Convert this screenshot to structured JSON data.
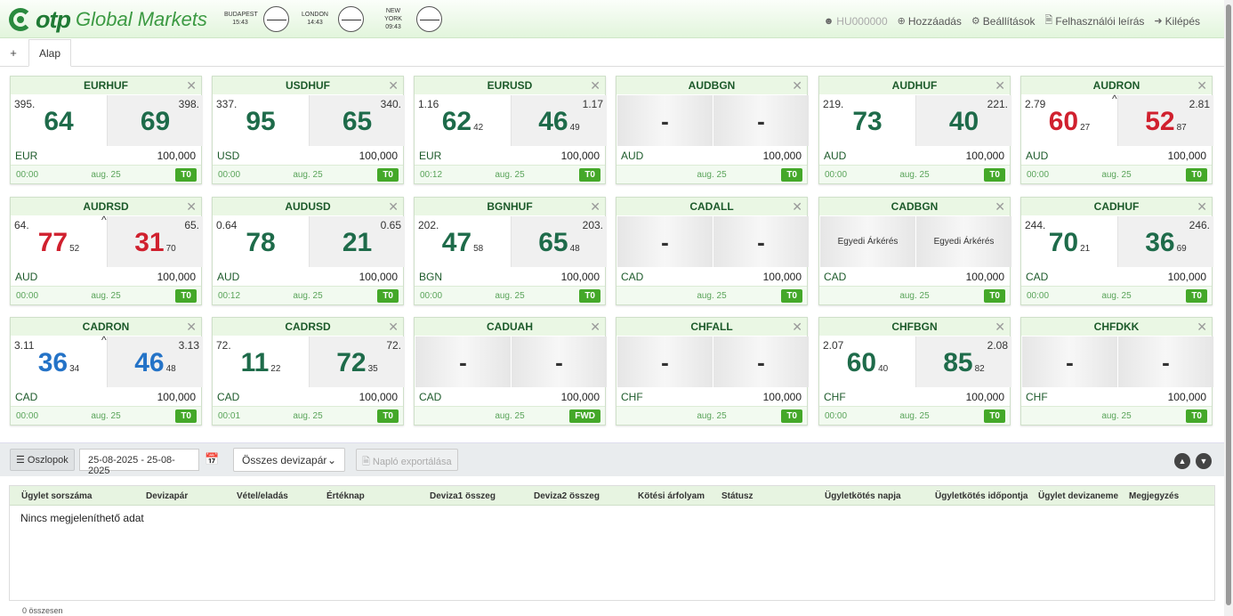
{
  "header": {
    "logo_brand": "otp",
    "logo_product": "Global Markets",
    "clocks": [
      {
        "city": "BUDAPEST",
        "time": "15:43"
      },
      {
        "city": "LONDON",
        "time": "14:43"
      },
      {
        "city": "NEW YORK",
        "time": "09:43"
      }
    ],
    "nav": {
      "user": "HU000000",
      "add": "Hozzáadás",
      "settings": "Beállítások",
      "manual": "Felhasználói leírás",
      "logout": "Kilépés"
    }
  },
  "tabs": {
    "add_symbol": "+",
    "active": "Alap"
  },
  "tiles": [
    {
      "pair": "EURHUF",
      "sell": {
        "pre": "395.",
        "big": "64",
        "small": ""
      },
      "buy": {
        "pre": "398.",
        "big": "69",
        "small": ""
      },
      "currency": "EUR",
      "amount": "100,000",
      "time": "00:00",
      "date": "aug. 25",
      "tenor": "T0"
    },
    {
      "pair": "USDHUF",
      "sell": {
        "pre": "337.",
        "big": "95",
        "small": ""
      },
      "buy": {
        "pre": "340.",
        "big": "65",
        "small": ""
      },
      "currency": "USD",
      "amount": "100,000",
      "time": "00:00",
      "date": "aug. 25",
      "tenor": "T0"
    },
    {
      "pair": "EURUSD",
      "sell": {
        "pre": "1.16",
        "big": "62",
        "small": "42"
      },
      "buy": {
        "pre": "1.17",
        "big": "46",
        "small": "49"
      },
      "currency": "EUR",
      "amount": "100,000",
      "time": "00:12",
      "date": "aug. 25",
      "tenor": "T0"
    },
    {
      "pair": "AUDBGN",
      "sell": {
        "pre": "",
        "big": "-",
        "small": ""
      },
      "buy": {
        "pre": "",
        "big": "-",
        "small": ""
      },
      "currency": "AUD",
      "amount": "100,000",
      "time": "",
      "date": "aug. 25",
      "tenor": "T0"
    },
    {
      "pair": "AUDHUF",
      "sell": {
        "pre": "219.",
        "big": "73",
        "small": ""
      },
      "buy": {
        "pre": "221.",
        "big": "40",
        "small": ""
      },
      "currency": "AUD",
      "amount": "100,000",
      "time": "00:00",
      "date": "aug. 25",
      "tenor": "T0"
    },
    {
      "pair": "AUDRON",
      "sell": {
        "pre": "2.79",
        "big": "60",
        "small": "27"
      },
      "buy": {
        "pre": "2.81",
        "big": "52",
        "small": "87"
      },
      "currency": "AUD",
      "amount": "100,000",
      "time": "00:00",
      "date": "aug. 25",
      "tenor": "T0",
      "arrow": "^"
    },
    {
      "pair": "AUDRSD",
      "sell": {
        "pre": "64.",
        "big": "77",
        "small": "52"
      },
      "buy": {
        "pre": "65.",
        "big": "31",
        "small": "70"
      },
      "currency": "AUD",
      "amount": "100,000",
      "time": "00:00",
      "date": "aug. 25",
      "tenor": "T0",
      "arrow": "^"
    },
    {
      "pair": "AUDUSD",
      "sell": {
        "pre": "0.64",
        "big": "78",
        "small": ""
      },
      "buy": {
        "pre": "0.65",
        "big": "21",
        "small": ""
      },
      "currency": "AUD",
      "amount": "100,000",
      "time": "00:12",
      "date": "aug. 25",
      "tenor": "T0"
    },
    {
      "pair": "BGNHUF",
      "sell": {
        "pre": "202.",
        "big": "47",
        "small": "58"
      },
      "buy": {
        "pre": "203.",
        "big": "65",
        "small": "48"
      },
      "currency": "BGN",
      "amount": "100,000",
      "time": "00:00",
      "date": "aug. 25",
      "tenor": "T0"
    },
    {
      "pair": "CADALL",
      "sell": {
        "pre": "",
        "big": "-",
        "small": ""
      },
      "buy": {
        "pre": "",
        "big": "-",
        "small": ""
      },
      "currency": "CAD",
      "amount": "100,000",
      "time": "",
      "date": "aug. 25",
      "tenor": "T0"
    },
    {
      "pair": "CADBGN",
      "sell": {
        "pre": "",
        "big": "",
        "small": "",
        "custom": "Egyedi Árkérés"
      },
      "buy": {
        "pre": "",
        "big": "",
        "small": "",
        "custom": "Egyedi Árkérés"
      },
      "currency": "CAD",
      "amount": "100,000",
      "time": "",
      "date": "aug. 25",
      "tenor": "T0"
    },
    {
      "pair": "CADHUF",
      "sell": {
        "pre": "244.",
        "big": "70",
        "small": "21"
      },
      "buy": {
        "pre": "246.",
        "big": "36",
        "small": "69"
      },
      "currency": "CAD",
      "amount": "100,000",
      "time": "00:00",
      "date": "aug. 25",
      "tenor": "T0"
    },
    {
      "pair": "CADRON",
      "sell": {
        "pre": "3.11",
        "big": "36",
        "small": "34"
      },
      "buy": {
        "pre": "3.13",
        "big": "46",
        "small": "48"
      },
      "currency": "CAD",
      "amount": "100,000",
      "time": "00:00",
      "date": "aug. 25",
      "tenor": "T0",
      "arrow": "^"
    },
    {
      "pair": "CADRSD",
      "sell": {
        "pre": "72.",
        "big": "11",
        "small": "22"
      },
      "buy": {
        "pre": "72.",
        "big": "72",
        "small": "35"
      },
      "currency": "CAD",
      "amount": "100,000",
      "time": "00:01",
      "date": "aug. 25",
      "tenor": "T0"
    },
    {
      "pair": "CADUAH",
      "sell": {
        "pre": "",
        "big": "-",
        "small": ""
      },
      "buy": {
        "pre": "",
        "big": "-",
        "small": ""
      },
      "currency": "CAD",
      "amount": "100,000",
      "time": "",
      "date": "aug. 25",
      "tenor": "FWD"
    },
    {
      "pair": "CHFALL",
      "sell": {
        "pre": "",
        "big": "-",
        "small": ""
      },
      "buy": {
        "pre": "",
        "big": "-",
        "small": ""
      },
      "currency": "CHF",
      "amount": "100,000",
      "time": "",
      "date": "aug. 25",
      "tenor": "T0"
    },
    {
      "pair": "CHFBGN",
      "sell": {
        "pre": "2.07",
        "big": "60",
        "small": "40"
      },
      "buy": {
        "pre": "2.08",
        "big": "85",
        "small": "82"
      },
      "currency": "CHF",
      "amount": "100,000",
      "time": "00:00",
      "date": "aug. 25",
      "tenor": "T0"
    },
    {
      "pair": "CHFDKK",
      "sell": {
        "pre": "",
        "big": "-",
        "small": ""
      },
      "buy": {
        "pre": "",
        "big": "-",
        "small": ""
      },
      "currency": "CHF",
      "amount": "100,000",
      "time": "",
      "date": "aug. 25",
      "tenor": "T0"
    }
  ],
  "toolbar": {
    "columns_label": "Oszlopok",
    "date_range": "25-08-2025 - 25-08-2025",
    "pair_filter": "Összes devizapár",
    "export_label": "Napló exportálása"
  },
  "grid": {
    "columns": [
      "Ügylet sorszáma",
      "Devizapár",
      "Vétel/eladás",
      "Értéknap",
      "Deviza1 összeg",
      "Deviza2 összeg",
      "Kötési árfolyam",
      "Státusz",
      "Ügyletkötés napja",
      "Ügyletkötés időpontja",
      "Ügylet devizaneme",
      "Megjegyzés"
    ],
    "empty_message": "Nincs megjeleníthető adat",
    "total": "0 összesen"
  },
  "colors": {
    "brand_green": "#1f7a34",
    "price_up": "#d0202e",
    "price_down": "#2473c7",
    "price_neutral": "#1e6b4a",
    "badge": "#44a829"
  }
}
